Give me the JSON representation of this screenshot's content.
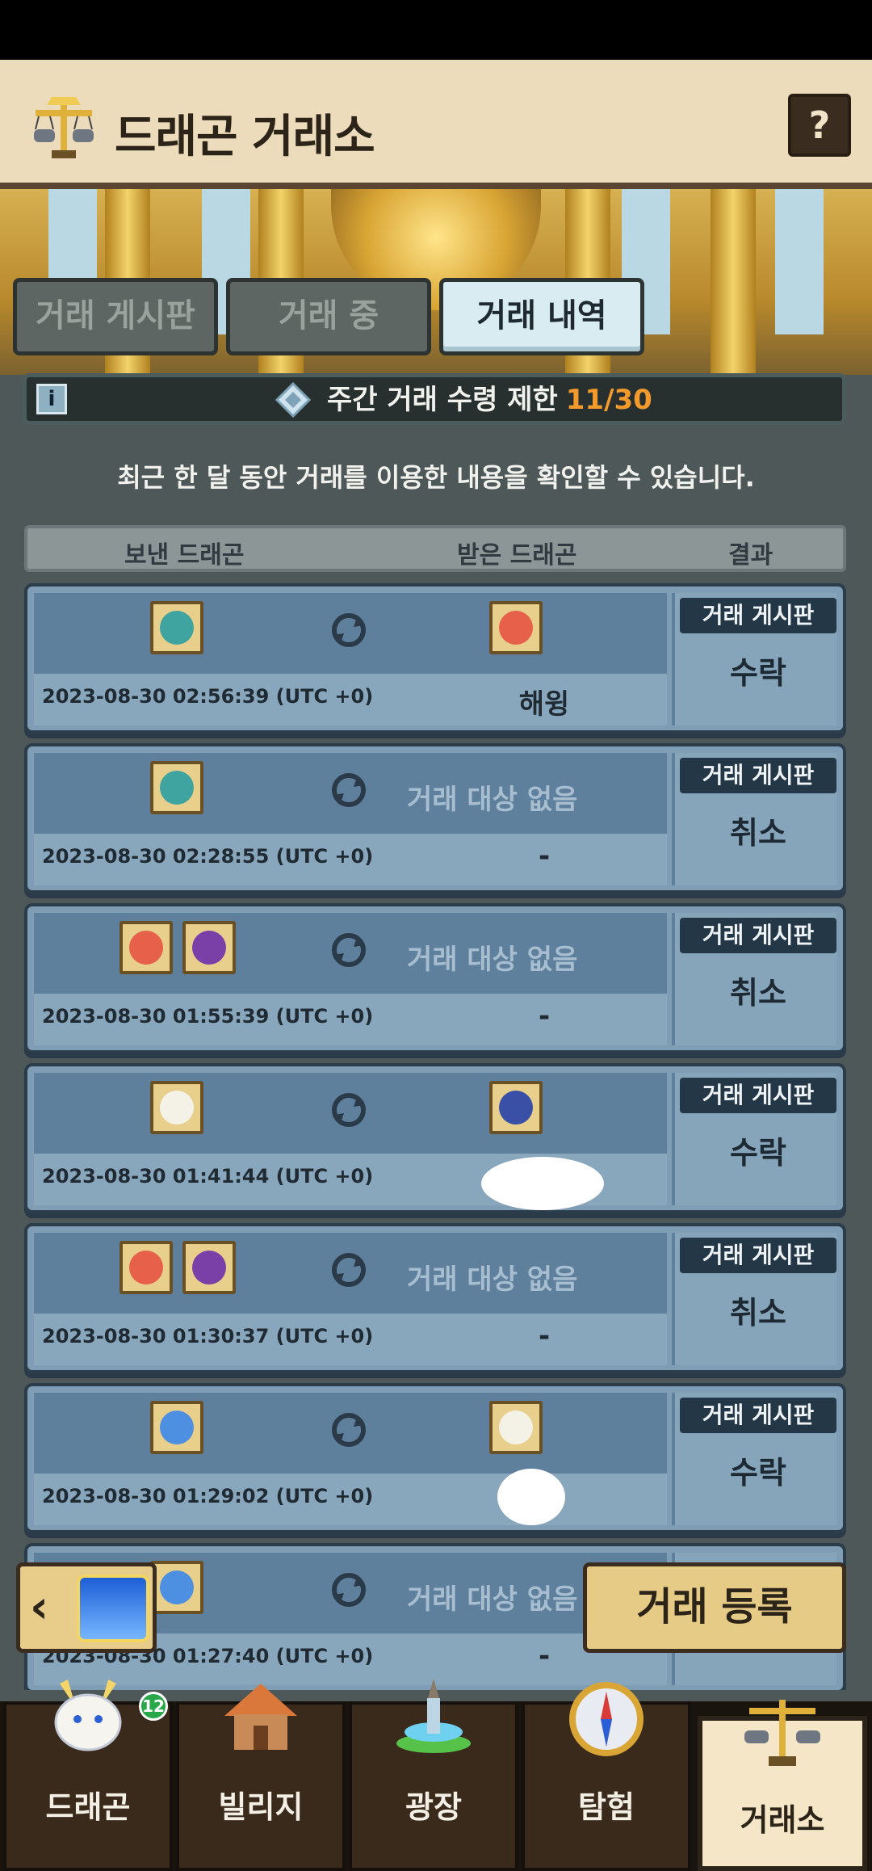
{
  "header": {
    "title": "드래곤 거래소",
    "help_label": "?"
  },
  "tabs": [
    {
      "label": "거래 게시판",
      "active": false
    },
    {
      "label": "거래 중",
      "active": false
    },
    {
      "label": "거래 내역",
      "active": true
    }
  ],
  "limit": {
    "info_icon": "i",
    "label": "주간 거래 수령 제한",
    "count": "11/30"
  },
  "description": "최근 한 달 동안 거래를 이용한 내용을 확인할 수 있습니다.",
  "columns": {
    "sent": "보낸 드래곤",
    "received": "받은 드래곤",
    "result": "결과"
  },
  "history": [
    {
      "date": "2023-08-30 02:56:39 (UTC +0)",
      "board": "거래 게시판",
      "result": "수락",
      "received_name": "해윙",
      "empty_label": "",
      "dash": ""
    },
    {
      "date": "2023-08-30 02:28:55 (UTC +0)",
      "board": "거래 게시판",
      "result": "취소",
      "received_name": "",
      "empty_label": "거래 대상 없음",
      "dash": "-"
    },
    {
      "date": "2023-08-30 01:55:39 (UTC +0)",
      "board": "거래 게시판",
      "result": "취소",
      "received_name": "",
      "empty_label": "거래 대상 없음",
      "dash": "-"
    },
    {
      "date": "2023-08-30 01:41:44 (UTC +0)",
      "board": "거래 게시판",
      "result": "수락",
      "received_name": "",
      "empty_label": "",
      "dash": ""
    },
    {
      "date": "2023-08-30 01:30:37 (UTC +0)",
      "board": "거래 게시판",
      "result": "취소",
      "received_name": "",
      "empty_label": "거래 대상 없음",
      "dash": "-"
    },
    {
      "date": "2023-08-30 01:29:02 (UTC +0)",
      "board": "거래 게시판",
      "result": "수락",
      "received_name": "",
      "empty_label": "",
      "dash": ""
    },
    {
      "date": "2023-08-30 01:27:40 (UTC +0)",
      "board": "",
      "result": "",
      "received_name": "",
      "empty_label": "거래 대상 없음",
      "dash": "-"
    }
  ],
  "buttons": {
    "back": "‹",
    "register": "거래 등록"
  },
  "nav": {
    "badge": "12",
    "items": [
      {
        "label": "드래곤",
        "icon": "dragon-icon"
      },
      {
        "label": "빌리지",
        "icon": "village-icon"
      },
      {
        "label": "광장",
        "icon": "fountain-icon"
      },
      {
        "label": "탐험",
        "icon": "compass-icon"
      },
      {
        "label": "거래소",
        "icon": "scales-icon"
      }
    ]
  }
}
